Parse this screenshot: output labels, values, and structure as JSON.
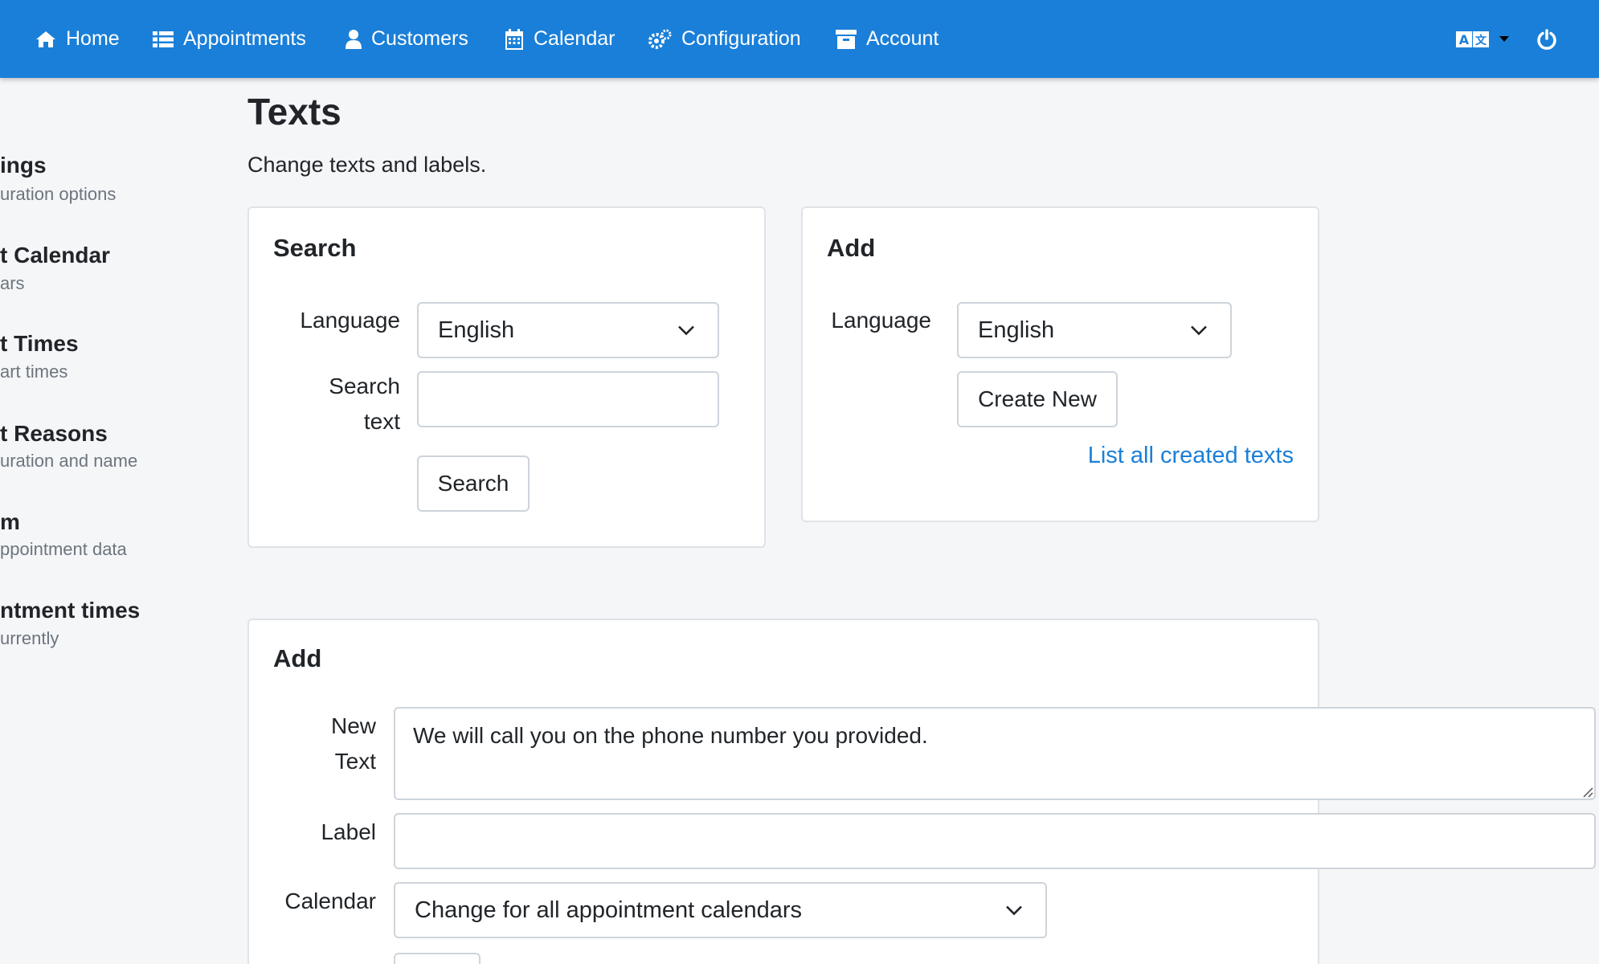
{
  "nav": {
    "items": [
      {
        "label": "Home",
        "icon": "home-icon"
      },
      {
        "label": "Appointments",
        "icon": "list-icon"
      },
      {
        "label": "Customers",
        "icon": "user-icon"
      },
      {
        "label": "Calendar",
        "icon": "calendar-icon"
      },
      {
        "label": "Configuration",
        "icon": "cogs-icon"
      },
      {
        "label": "Account",
        "icon": "archive-icon"
      }
    ],
    "language_icon": "translate-icon",
    "power_icon": "power-icon",
    "bar_color": "#1a7fd8"
  },
  "sidebar": {
    "items": [
      {
        "title": "ings",
        "subtitle": "uration options"
      },
      {
        "title": "t Calendar",
        "subtitle": "ars"
      },
      {
        "title": "t Times",
        "subtitle": "art times"
      },
      {
        "title": "t Reasons",
        "subtitle": "uration and name"
      },
      {
        "title": "m",
        "subtitle": "ppointment data"
      },
      {
        "title": "ntment times",
        "subtitle": "urrently"
      }
    ]
  },
  "page": {
    "title": "Texts",
    "subtitle": "Change texts and labels."
  },
  "search_card": {
    "title": "Search",
    "language_label": "Language",
    "language_value": "English",
    "search_text_label_1": "Search",
    "search_text_label_2": "text",
    "search_value": "",
    "button": "Search"
  },
  "add_card": {
    "title": "Add",
    "language_label": "Language",
    "language_value": "English",
    "create_button": "Create New",
    "list_link": "List all created texts"
  },
  "add_form": {
    "title": "Add",
    "new_text_label_1": "New",
    "new_text_label_2": "Text",
    "new_text_value": "We will call you on the phone number you provided.",
    "label_label": "Label",
    "label_value": "",
    "calendar_label": "Calendar",
    "calendar_value": "Change for all appointment calendars"
  }
}
